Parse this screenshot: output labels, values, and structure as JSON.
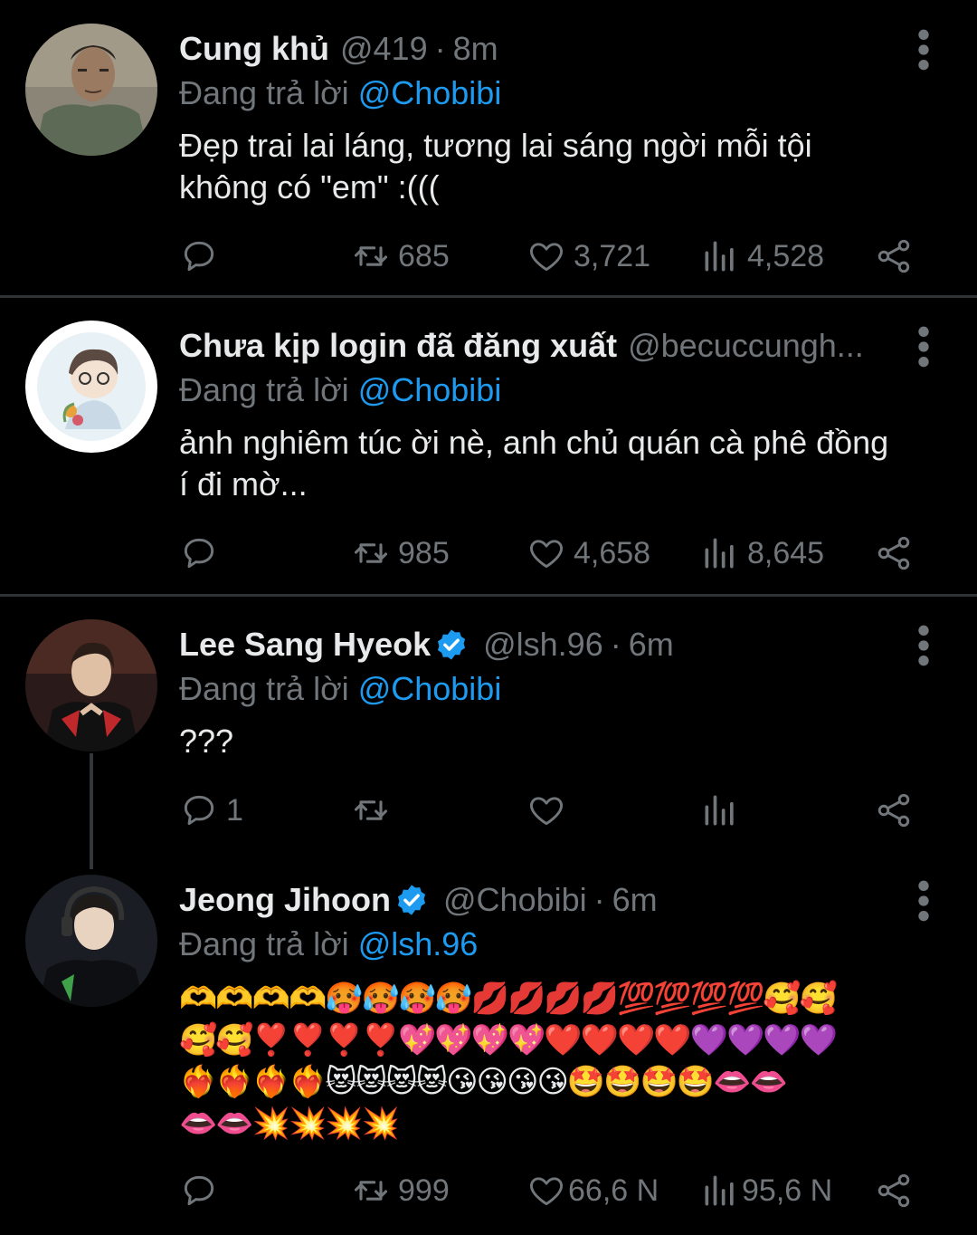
{
  "tweets": [
    {
      "name": "Cung khủ",
      "handle": "@419",
      "dot": "·",
      "time": "8m",
      "reply_prefix": "Đang trả lời",
      "reply_mention": "@Chobibi",
      "text_lines": [
        "Đẹp trai lai láng, tương lai sáng ngời mỗi tội",
        "không có \"em\" :((("
      ],
      "retweets": "685",
      "likes": "3,721",
      "views": "4,528"
    },
    {
      "name": "Chưa kịp login đã đăng xuất",
      "handle": "@becuccungh...",
      "reply_prefix": "Đang trả lời",
      "reply_mention": "@Chobibi",
      "text_lines": [
        "ảnh nghiêm túc ời nè, anh chủ quán cà phê đồng",
        "í đi mờ..."
      ],
      "retweets": "985",
      "likes": "4,658",
      "views": "8,645"
    },
    {
      "name": "Lee Sang Hyeok",
      "handle": "@lsh.96",
      "dot": "·",
      "time": "6m",
      "reply_prefix": "Đang trả lời",
      "reply_mention": "@Chobibi",
      "text_lines": [
        "???"
      ],
      "replies": "1",
      "retweets": "",
      "likes": "",
      "views": ""
    },
    {
      "name": "Jeong Jihoon",
      "handle": "@Chobibi",
      "dot": "·",
      "time": "6m",
      "reply_prefix": "Đang trả lời",
      "reply_mention": "@lsh.96",
      "emoji_lines": [
        "🫶🫶🫶🫶🥵🥵🥵🥵💋💋💋💋💯💯💯💯🥰🥰",
        "🥰🥰❣️❣️❣️❣️💖💖💖💖❤️❤️❤️❤️💜💜💜💜",
        "❤️‍🔥❤️‍🔥❤️‍🔥❤️‍🔥😻😻😻😻😘😘😘😘🤩🤩🤩🤩👄👄",
        "👄👄💥💥💥💥"
      ],
      "retweets": "999",
      "likes": "66,6 N",
      "views": "95,6 N"
    }
  ],
  "colors": {
    "background": "#000000",
    "text": "#e7e9ea",
    "muted": "#71767b",
    "accent": "#1d9bf0",
    "divider": "#2f3336"
  },
  "icons": [
    "reply-icon",
    "retweet-icon",
    "like-icon",
    "views-icon",
    "share-icon",
    "more-icon",
    "verified-badge-icon"
  ]
}
